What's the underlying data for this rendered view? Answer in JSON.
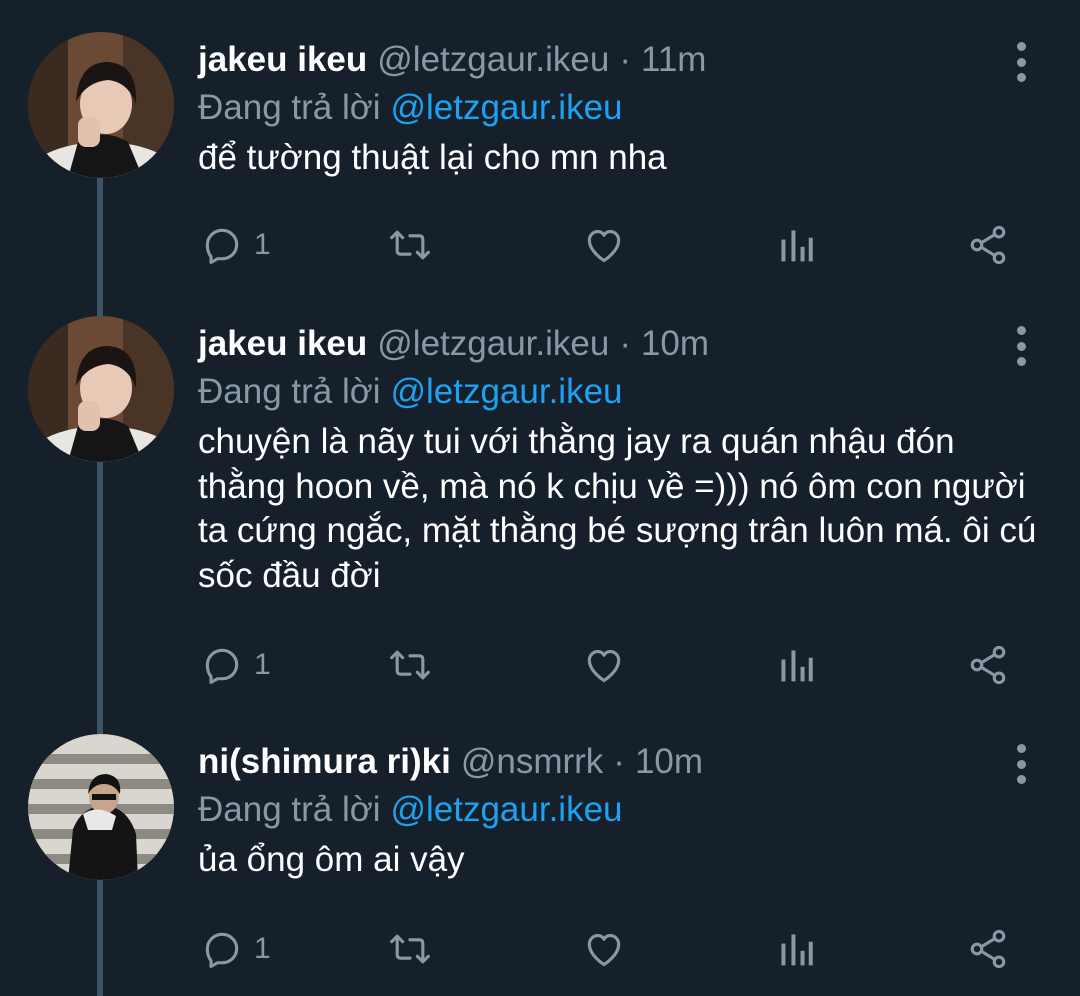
{
  "tweets": [
    {
      "name": "jakeu ikeu",
      "handle": "@letzgaur.ikeu",
      "time": "11m",
      "reply_prefix": "Đang trả lời",
      "reply_to": "@letzgaur.ikeu",
      "text": "để tường thuật lại cho mn nha",
      "reply_count": "1"
    },
    {
      "name": "jakeu ikeu",
      "handle": "@letzgaur.ikeu",
      "time": "10m",
      "reply_prefix": "Đang trả lời",
      "reply_to": "@letzgaur.ikeu",
      "text": "chuyện là nãy tui với thằng jay ra quán nhậu đón thằng hoon về, mà nó k chịu về =))) nó ôm con người ta cứng ngắc, mặt thằng bé sượng trân luôn má. ôi cú sốc đầu đời",
      "reply_count": "1"
    },
    {
      "name": "ni(shimura ri)ki",
      "handle": "@nsmrrk",
      "time": "10m",
      "reply_prefix": "Đang trả lời",
      "reply_to": "@letzgaur.ikeu",
      "text": "ủa ổng ôm ai vậy",
      "reply_count": "1"
    }
  ],
  "separator": "·",
  "icons": [
    "more-vertical-icon",
    "reply-icon",
    "retweet-icon",
    "like-icon",
    "analytics-icon",
    "share-icon"
  ],
  "colors": {
    "background": "#15202b",
    "text": "#ffffff",
    "muted": "#8899a6",
    "link": "#1da1f2",
    "thread_line": "#3d5466"
  }
}
